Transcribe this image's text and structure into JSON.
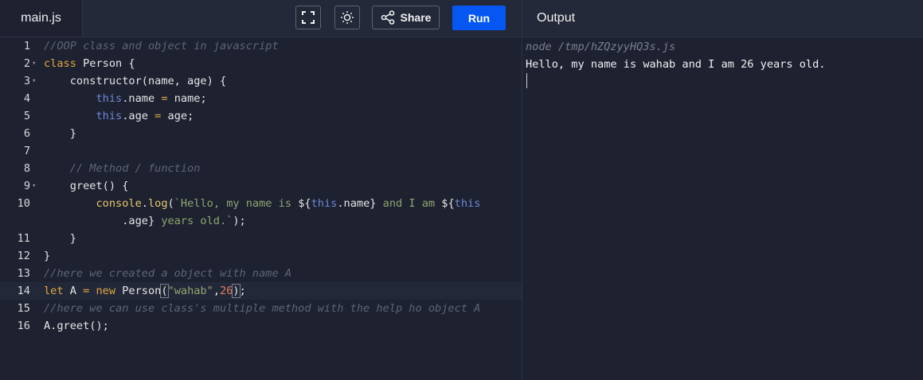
{
  "tabs": {
    "file_label": "main.js",
    "output_label": "Output"
  },
  "toolbar": {
    "share_label": "Share",
    "run_label": "Run"
  },
  "icons": {
    "fullscreen": "fullscreen-icon",
    "theme": "sun-icon",
    "share": "share-icon"
  },
  "colors": {
    "run": "#0556f3",
    "background": "#1d2130"
  },
  "code": [
    {
      "num": "1",
      "fold": false,
      "tokens": [
        {
          "t": "cm",
          "v": "//OOP class and object in javascript"
        }
      ]
    },
    {
      "num": "2",
      "fold": true,
      "tokens": [
        {
          "t": "kw",
          "v": "class"
        },
        {
          "t": "",
          "v": " Person {"
        }
      ]
    },
    {
      "num": "3",
      "fold": true,
      "tokens": [
        {
          "t": "",
          "v": "    constructor(name, age) {"
        }
      ]
    },
    {
      "num": "4",
      "fold": false,
      "tokens": [
        {
          "t": "",
          "v": "        "
        },
        {
          "t": "th",
          "v": "this"
        },
        {
          "t": "",
          "v": ".name "
        },
        {
          "t": "kw",
          "v": "="
        },
        {
          "t": "",
          "v": " name;"
        }
      ]
    },
    {
      "num": "5",
      "fold": false,
      "tokens": [
        {
          "t": "",
          "v": "        "
        },
        {
          "t": "th",
          "v": "this"
        },
        {
          "t": "",
          "v": ".age "
        },
        {
          "t": "kw",
          "v": "="
        },
        {
          "t": "",
          "v": " age;"
        }
      ]
    },
    {
      "num": "6",
      "fold": false,
      "tokens": [
        {
          "t": "",
          "v": "    }"
        }
      ]
    },
    {
      "num": "7",
      "fold": false,
      "tokens": []
    },
    {
      "num": "8",
      "fold": false,
      "tokens": [
        {
          "t": "cm",
          "v": "    // Method / function"
        }
      ]
    },
    {
      "num": "9",
      "fold": true,
      "tokens": [
        {
          "t": "",
          "v": "    greet() {"
        }
      ]
    },
    {
      "num": "10",
      "fold": false,
      "tokens": [
        {
          "t": "",
          "v": "        "
        },
        {
          "t": "fn",
          "v": "console"
        },
        {
          "t": "",
          "v": "."
        },
        {
          "t": "fn",
          "v": "log"
        },
        {
          "t": "",
          "v": "("
        },
        {
          "t": "str",
          "v": "`Hello, my name is "
        },
        {
          "t": "",
          "v": "${"
        },
        {
          "t": "th",
          "v": "this"
        },
        {
          "t": "",
          "v": ".name}"
        },
        {
          "t": "str",
          "v": " and I am "
        },
        {
          "t": "",
          "v": "${"
        },
        {
          "t": "th",
          "v": "this"
        }
      ]
    },
    {
      "num": "",
      "fold": false,
      "tokens": [
        {
          "t": "",
          "v": "            .age}"
        },
        {
          "t": "str",
          "v": " years old.`"
        },
        {
          "t": "",
          "v": ");"
        }
      ]
    },
    {
      "num": "11",
      "fold": false,
      "tokens": [
        {
          "t": "",
          "v": "    }"
        }
      ]
    },
    {
      "num": "12",
      "fold": false,
      "tokens": [
        {
          "t": "",
          "v": "}"
        }
      ]
    },
    {
      "num": "13",
      "fold": false,
      "tokens": [
        {
          "t": "cm",
          "v": "//here we created a object with name A"
        }
      ]
    },
    {
      "num": "14",
      "fold": false,
      "active": true,
      "tokens": [
        {
          "t": "kw",
          "v": "let"
        },
        {
          "t": "",
          "v": " A "
        },
        {
          "t": "kw",
          "v": "="
        },
        {
          "t": "",
          "v": " "
        },
        {
          "t": "kw",
          "v": "new"
        },
        {
          "t": "",
          "v": " Person"
        },
        {
          "t": "paren",
          "v": "("
        },
        {
          "t": "str",
          "v": "\"wahab\""
        },
        {
          "t": "",
          "v": ","
        },
        {
          "t": "num",
          "v": "26"
        },
        {
          "t": "paren",
          "v": ")"
        },
        {
          "t": "",
          "v": ";"
        }
      ]
    },
    {
      "num": "15",
      "fold": false,
      "tokens": [
        {
          "t": "cm",
          "v": "//here we can use class's multiple method with the help ho object A"
        }
      ]
    },
    {
      "num": "16",
      "fold": false,
      "tokens": [
        {
          "t": "",
          "v": "A.greet();"
        }
      ]
    }
  ],
  "output": {
    "command": "node /tmp/hZQzyyHQ3s.js",
    "lines": [
      "Hello, my name is wahab and I am 26 years old."
    ]
  }
}
